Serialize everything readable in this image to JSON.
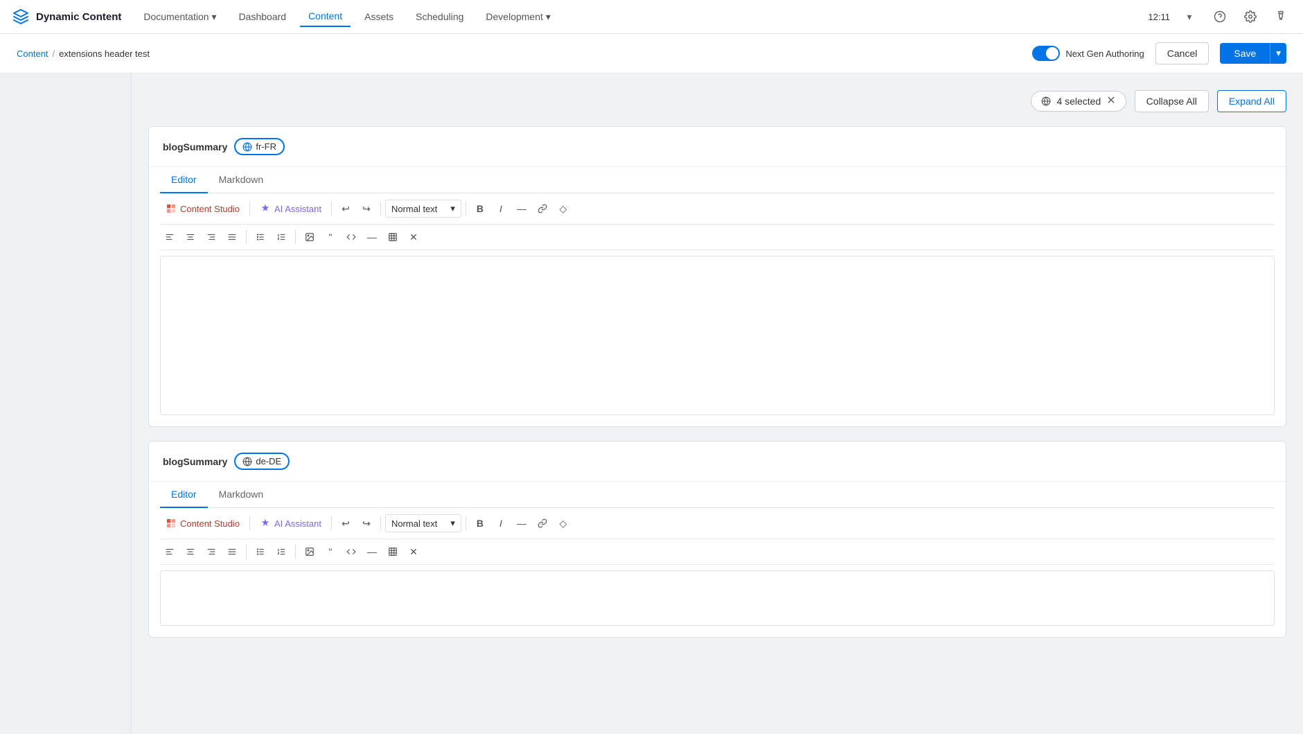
{
  "app": {
    "title": "Dynamic Content",
    "time": "12:11"
  },
  "nav": {
    "items": [
      {
        "label": "Documentation",
        "has_arrow": true,
        "active": false
      },
      {
        "label": "Dashboard",
        "has_arrow": false,
        "active": false
      },
      {
        "label": "Content",
        "has_arrow": false,
        "active": true
      },
      {
        "label": "Assets",
        "has_arrow": false,
        "active": false
      },
      {
        "label": "Scheduling",
        "has_arrow": false,
        "active": false
      },
      {
        "label": "Development",
        "has_arrow": true,
        "active": false
      }
    ]
  },
  "breadcrumb": {
    "root": "Content",
    "separator": "/",
    "current": "extensions header test"
  },
  "breadcrumb_right": {
    "toggle_label": "Next Gen Authoring",
    "cancel_label": "Cancel",
    "save_label": "Save"
  },
  "locale_bar": {
    "selected_count": "4 selected",
    "collapse_label": "Collapse All",
    "expand_label": "Expand All"
  },
  "fields": [
    {
      "name": "blogSummary",
      "locale": "fr-FR",
      "locale_highlighted": true,
      "tabs": [
        "Editor",
        "Markdown"
      ],
      "active_tab": "Editor",
      "toolbar": {
        "content_studio": "Content Studio",
        "ai_assistant": "AI Assistant",
        "text_format": "Normal text",
        "bold": "B",
        "italic": "I"
      }
    },
    {
      "name": "blogSummary",
      "locale": "de-DE",
      "locale_highlighted": false,
      "tabs": [
        "Editor",
        "Markdown"
      ],
      "active_tab": "Editor",
      "toolbar": {
        "content_studio": "Content Studio",
        "ai_assistant": "AI Assistant",
        "text_format": "Normal text",
        "bold": "B",
        "italic": "I"
      }
    }
  ]
}
